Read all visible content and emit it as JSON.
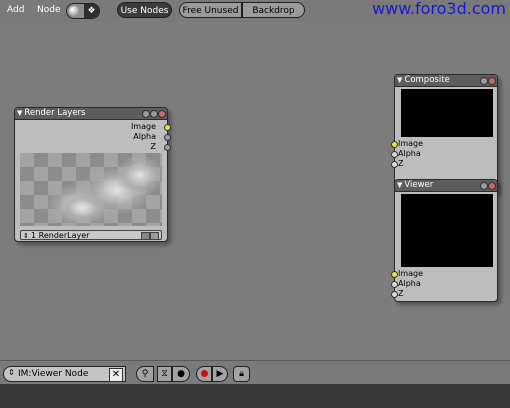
{
  "header": {
    "menu_add": "Add",
    "menu_node": "Node",
    "use_nodes_label": "Use Nodes",
    "free_unused_label": "Free Unused",
    "backdrop_label": "Backdrop",
    "watermark": "www.foro3d.com"
  },
  "nodes": {
    "render_layers": {
      "title": "Render Layers",
      "outputs": [
        "Image",
        "Alpha",
        "Z"
      ],
      "layer_select": "1 RenderLayer"
    },
    "composite": {
      "title": "Composite",
      "inputs": [
        "Image",
        "Alpha",
        "Z"
      ]
    },
    "viewer": {
      "title": "Viewer",
      "inputs": [
        "Image",
        "Alpha",
        "Z"
      ]
    }
  },
  "footer": {
    "image_name_field": "IM:Viewer Node",
    "clear_icon": "x-icon"
  },
  "colors": {
    "canvas": "#7c7c7c",
    "node_body": "#bdbdbd",
    "node_header": "#5d5d5d",
    "socket_image": "#e6e33a",
    "watermark": "#1a1ad6"
  }
}
